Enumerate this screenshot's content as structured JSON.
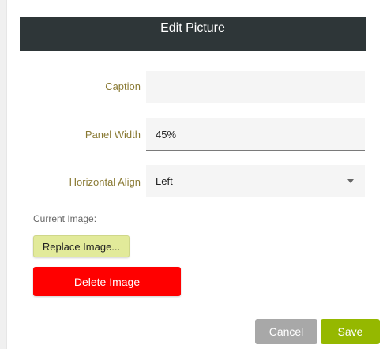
{
  "dialog": {
    "title": "Edit Picture"
  },
  "fields": {
    "caption": {
      "label": "Caption",
      "value": ""
    },
    "panel_width": {
      "label": "Panel Width",
      "value": "45%"
    },
    "horizontal_align": {
      "label": "Horizontal Align",
      "value": "Left"
    }
  },
  "image": {
    "current_label": "Current Image:",
    "replace_label": "Replace Image...",
    "delete_label": "Delete Image"
  },
  "actions": {
    "cancel_label": "Cancel",
    "save_label": "Save"
  },
  "colors": {
    "title_bar": "#2e3638",
    "label_text": "#8a7a34",
    "replace_button": "#e2ea9a",
    "delete_button": "#ff0000",
    "cancel_button": "#a8a8a8",
    "save_button": "#95b800"
  }
}
